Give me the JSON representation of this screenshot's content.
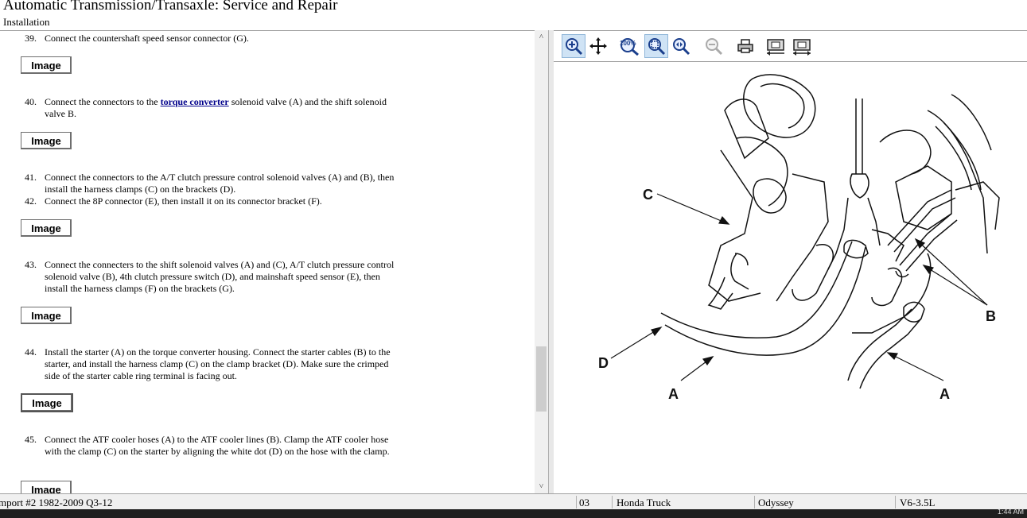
{
  "header": {
    "title": "Automatic Transmission/Transaxle:  Service and Repair",
    "subtitle": "Installation"
  },
  "steps": [
    {
      "num": "39.",
      "text": "Connect the countershaft speed sensor connector (G)."
    },
    {
      "num": "40.",
      "text_before": "Connect the connectors to the ",
      "link": "torque converter",
      "text_after": " solenoid valve (A) and the shift solenoid valve B."
    },
    {
      "num": "41.",
      "text": "Connect the connectors to the A/T clutch pressure control solenoid valves (A) and (B), then install the harness clamps (C) on the brackets (D)."
    },
    {
      "num": "42.",
      "text": "Connect the 8P connector (E), then install it on its connector bracket (F)."
    },
    {
      "num": "43.",
      "text": "Connect the connecters to the shift solenoid valves (A) and (C), A/T clutch pressure control solenoid valve (B), 4th clutch pressure switch (D), and mainshaft speed sensor (E), then install the harness clamps (F) on the brackets (G)."
    },
    {
      "num": "44.",
      "text": "Install the starter (A) on the torque converter housing. Connect the starter cables (B) to the starter, and install the harness clamp (C) on the clamp bracket (D). Make sure the crimped side of the starter cable ring terminal is facing out."
    },
    {
      "num": "45.",
      "text": "Connect the ATF cooler hoses (A) to the ATF cooler lines (B). Clamp the ATF cooler hose with the clamp (C) on the starter by aligning the white dot (D) on the hose with the clamp."
    }
  ],
  "image_button_label": "Image",
  "toolbar": {
    "buttons": [
      "zoom-in-icon",
      "pan-icon",
      "zoom-100-icon",
      "zoom-fit-icon",
      "zoom-area-icon",
      "zoom-out-icon",
      "print-icon",
      "fit-height-icon",
      "fit-width-icon"
    ],
    "zoom100_text": "100%"
  },
  "diagram": {
    "labels": {
      "c": "C",
      "b": "B",
      "d": "D",
      "a1": "A",
      "a2": "A"
    }
  },
  "status_bar": {
    "source": "mport #2 1982-2009 Q3-12",
    "code": "03",
    "make": "Honda Truck",
    "model": "Odyssey",
    "engine": "V6-3.5L"
  },
  "taskbar": {
    "clock": "1:44 AM"
  }
}
